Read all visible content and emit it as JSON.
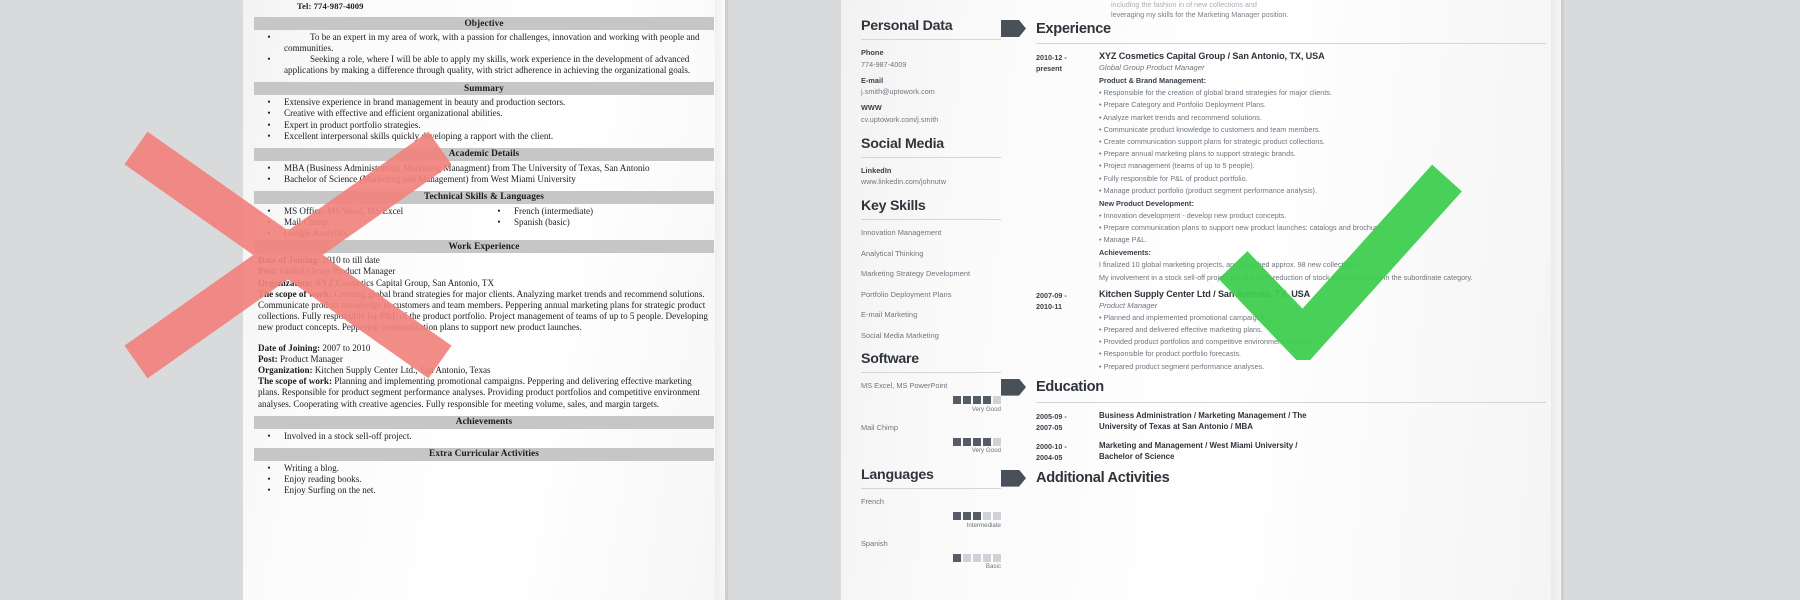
{
  "background_color": "#d9dadb",
  "marks": {
    "reject": {
      "icon": "x-icon",
      "color": "#f2837e",
      "meaning": "bad resume"
    },
    "accept": {
      "icon": "check-icon",
      "color": "#3ece4f",
      "meaning": "good resume"
    }
  },
  "bad_resume": {
    "top_line": "Tel: 774-987-4009",
    "sections": [
      {
        "title": "Objective",
        "type": "bullets",
        "items": [
          "To be an expert in my area of work, with a passion for challenges, innovation and working with people and communities.",
          "Seeking a role, where I will be able to apply my skills, work experience in the development of advanced applications by making a difference through quality, with strict adherence in achieving the organizational goals."
        ]
      },
      {
        "title": "Summary",
        "type": "bullets",
        "items": [
          "Extensive experience in brand management in beauty and production sectors.",
          "Creative with effective and efficient organizational abilities.",
          "Expert in product portfolio strategies.",
          "Excellent interpersonal skills quickly developing a rapport with the client."
        ]
      },
      {
        "title": "Academic Details",
        "type": "bullets",
        "items": [
          "MBA (Business Administration, Marketing Managment) from The University of Texas, San Antonio",
          "Bachelor of Science (Marketing and Management) from West Miami University"
        ]
      },
      {
        "title": "Technical Skills & Languages",
        "type": "two-column-bullets",
        "left": [
          "MS Office: MS Word, MS Excel",
          "Mail Chimp",
          "Google Analytics"
        ],
        "right": [
          "French (intermediate)",
          "Spanish (basic)"
        ]
      },
      {
        "title": "Work Experience",
        "type": "jobs",
        "jobs": [
          {
            "date_label": "Date of Joining:",
            "date_value": "2010 to till date",
            "post_label": "Post:",
            "post_value": "Global Group Product Manager",
            "org_label": "Organization:",
            "org_value": "XYZ Cosmetics Capital Group, San Antonio, TX",
            "scope_label": "The scope of work:",
            "scope_value": "Creating global brand strategies for major clients. Analyzing market trends and recommend solutions. Communicate product knowledge to customers and team members. Peppering annual marketing plans for strategic product collections. Fully responsible for P&L of the product portfolio. Project management of teams of up to 5 people. Developing new product concepts. Peppering communication plans  to support new product launches."
          },
          {
            "date_label": "Date of Joining:",
            "date_value": "2007 to 2010",
            "post_label": "Post:",
            "post_value": "Product Manager",
            "org_label": "Organization:",
            "org_value": "Kitchen Supply Center Ltd., San Antonio, Texas",
            "scope_label": "The scope of work:",
            "scope_value": "Planning and implementing promotional campaigns. Peppering and delivering effective marketing plans. Responsible for product segment performance analyses. Providing product portfolios and competitive environment analyses. Cooperating with creative agencies. Fully responsible for meeting volume, sales, and margin targets."
          }
        ]
      },
      {
        "title": "Achievements",
        "type": "bullets",
        "items": [
          "Involved in a stock sell-off project."
        ]
      },
      {
        "title": "Extra Curricular Activities",
        "type": "bullets",
        "items": [
          "Writing a blog.",
          "Enjoy reading books.",
          "Enjoy Surfing on the net."
        ]
      }
    ]
  },
  "good_resume": {
    "header_tail": {
      "line1": "including the fashion in of new collections and",
      "line2": "leveraging my skills for the Marketing Manager position."
    },
    "sidebar": {
      "personal_data": {
        "heading": "Personal Data",
        "fields": [
          {
            "label": "Phone",
            "value": "774-987-4009"
          },
          {
            "label": "E-mail",
            "value": "j.smith@uptowork.com"
          },
          {
            "label": "WWW",
            "value": "cv.uptowork.com/j.smith"
          }
        ]
      },
      "social_media": {
        "heading": "Social Media",
        "fields": [
          {
            "label": "LinkedIn",
            "value": "www.linkedin.com/johnutw"
          }
        ]
      },
      "key_skills": {
        "heading": "Key Skills",
        "items": [
          "Innovation Management",
          "Analytical Thinking",
          "Marketing Strategy Development",
          "Portfolio Deployment Plans",
          "E-mail Marketing",
          "Social Media Marketing"
        ]
      },
      "software": {
        "heading": "Software",
        "items": [
          {
            "name": "MS Excel, MS PowerPoint",
            "level": 4,
            "max": 5,
            "level_label": "Very Good"
          },
          {
            "name": "Mail Chimp",
            "level": 4,
            "max": 5,
            "level_label": "Very Good"
          }
        ]
      },
      "languages": {
        "heading": "Languages",
        "items": [
          {
            "name": "French",
            "level": 3,
            "max": 5,
            "level_label": "Intermediate"
          },
          {
            "name": "Spanish",
            "level": 1,
            "max": 5,
            "level_label": "Basic"
          }
        ]
      }
    },
    "experience": {
      "heading": "Experience",
      "entries": [
        {
          "dates": "2010-12 -\npresent",
          "dates_line1": "2010-12 -",
          "dates_line2": "present",
          "organization": "XYZ Cosmetics Capital Group / San Antonio, TX, USA",
          "position": "Global Group Product Manager",
          "groups": [
            {
              "title": "Product & Brand Management:",
              "bullets": [
                "Responsible for the creation of global brand strategies for major clients.",
                "Prepare Category and Portfolio Deployment Plans.",
                "Analyze market trends and recommend solutions.",
                "Communicate product knowledge to customers and team members.",
                "Create communication support plans for strategic product collections.",
                "Prepare annual marketing plans to support strategic brands.",
                "Project management (teams of up to 5 people).",
                "Fully responsible for P&L of product portfolio.",
                "Manage product portfolio (product segment performance analysis)."
              ]
            },
            {
              "title": "New Product Development:",
              "bullets": [
                "Innovation development - develop new product concepts.",
                "Prepare communication plans to support new product launches: catalogs and brochures.",
                "Manage P&L."
              ]
            }
          ],
          "achievements_title": "Achievements:",
          "achievements": [
            "I finalized 10 global marketing projects, and launched approx. 98 new collections.",
            "My involvement in a stock sell-off project led to a 19% reduction of stock within 3 months in the subordinate category."
          ]
        },
        {
          "dates_line1": "2007-09 -",
          "dates_line2": "2010-11",
          "organization": "Kitchen Supply Center Ltd / San Antonio, TX, USA",
          "position": "Product Manager",
          "groups": [
            {
              "title": "",
              "bullets": [
                "Planned and implemented promotional campaigns.",
                "Prepared and delivered effective marketing plans.",
                "Provided product portfolios and competitive environment analyses.",
                "Responsible for product portfolio forecasts.",
                "Prepared product segment performance analyses."
              ]
            }
          ]
        }
      ]
    },
    "education": {
      "heading": "Education",
      "entries": [
        {
          "dates_line1": "2005-09 -",
          "dates_line2": "2007-05",
          "title_line1": "Business Administration / Marketing Management / The",
          "title_line2": "University of Texas at San Antonio / MBA"
        },
        {
          "dates_line1": "2000-10 -",
          "dates_line2": "2004-05",
          "title_line1": "Marketing and Management / West Miami University /",
          "title_line2": "Bachelor of Science"
        }
      ]
    },
    "additional_activities": {
      "heading": "Additional Activities"
    }
  }
}
